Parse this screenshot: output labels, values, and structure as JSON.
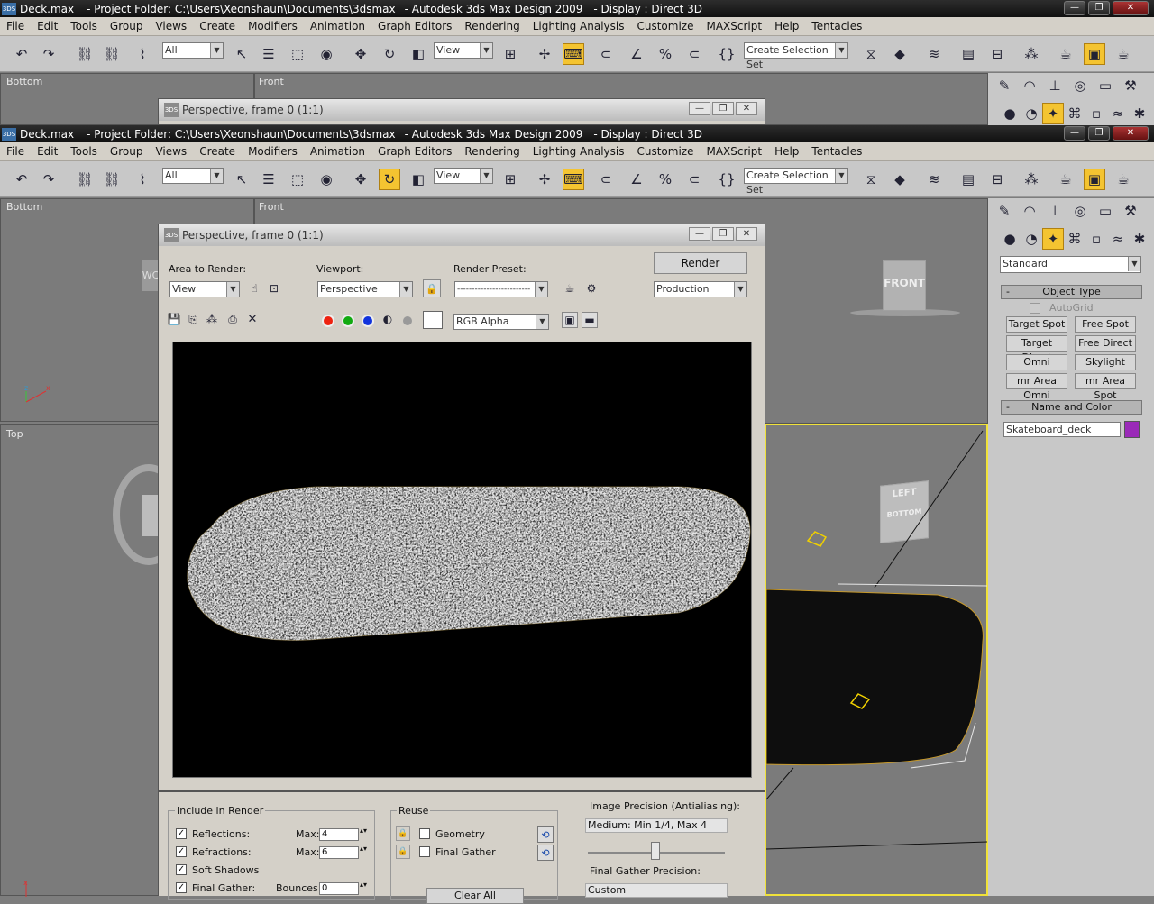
{
  "window": {
    "file": "Deck.max",
    "project": "- Project Folder: C:\\Users\\Xeonshaun\\Documents\\3dsmax",
    "app": "- Autodesk 3ds Max Design 2009",
    "display": "- Display : Direct 3D"
  },
  "menu": [
    "File",
    "Edit",
    "Tools",
    "Group",
    "Views",
    "Create",
    "Modifiers",
    "Animation",
    "Graph Editors",
    "Rendering",
    "Lighting Analysis",
    "Customize",
    "MAXScript",
    "Help",
    "Tentacles"
  ],
  "toolbar": {
    "selection_filter": "All",
    "ref_coord": "View",
    "named_selection": "Create Selection Set",
    "snap_label": "3"
  },
  "viewports": {
    "bottom": "Bottom",
    "front": "Front",
    "top": "Top",
    "viewcube_front": "FRONT",
    "viewcube_left": "LEFT",
    "viewcube_bottom": "BOTTOM",
    "left_cube_stub": "WC"
  },
  "command_panel": {
    "category": "Standard",
    "object_type_title": "Object Type",
    "autogrid": "AutoGrid",
    "buttons": [
      "Target Spot",
      "Free Spot",
      "Target Direct",
      "Free Direct",
      "Omni",
      "Skylight",
      "mr Area Omni",
      "mr Area Spot"
    ],
    "name_color_title": "Name and Color",
    "object_name": "Skateboard_deck",
    "object_color": "#9a2ab8"
  },
  "render_frame": {
    "title": "Perspective, frame 0 (1:1)",
    "area_to_render_label": "Area to Render:",
    "area_to_render": "View",
    "viewport_label": "Viewport:",
    "viewport": "Perspective",
    "preset_label": "Render Preset:",
    "preset": "-------------------------",
    "render_button": "Render",
    "mode": "Production",
    "channel": "RGB Alpha"
  },
  "bottom_panel": {
    "include_title": "Include in Render",
    "reflections": "Reflections:",
    "refractions": "Refractions:",
    "soft_shadows": "Soft Shadows",
    "final_gather": "Final Gather:",
    "max_label": "Max:",
    "reflections_max": "4",
    "refractions_max": "6",
    "bounces_label": "Bounces:",
    "bounces": "0",
    "reuse_title": "Reuse",
    "geometry": "Geometry",
    "final_gather_reuse": "Final Gather",
    "clear_all": "Clear All",
    "image_precision_label": "Image Precision (Antialiasing):",
    "image_precision": "Medium: Min 1/4, Max 4",
    "fg_precision_label": "Final Gather Precision:",
    "fg_precision": "Custom"
  },
  "colors": {
    "highlight": "#f4c431",
    "selection": "#f0e23a"
  }
}
